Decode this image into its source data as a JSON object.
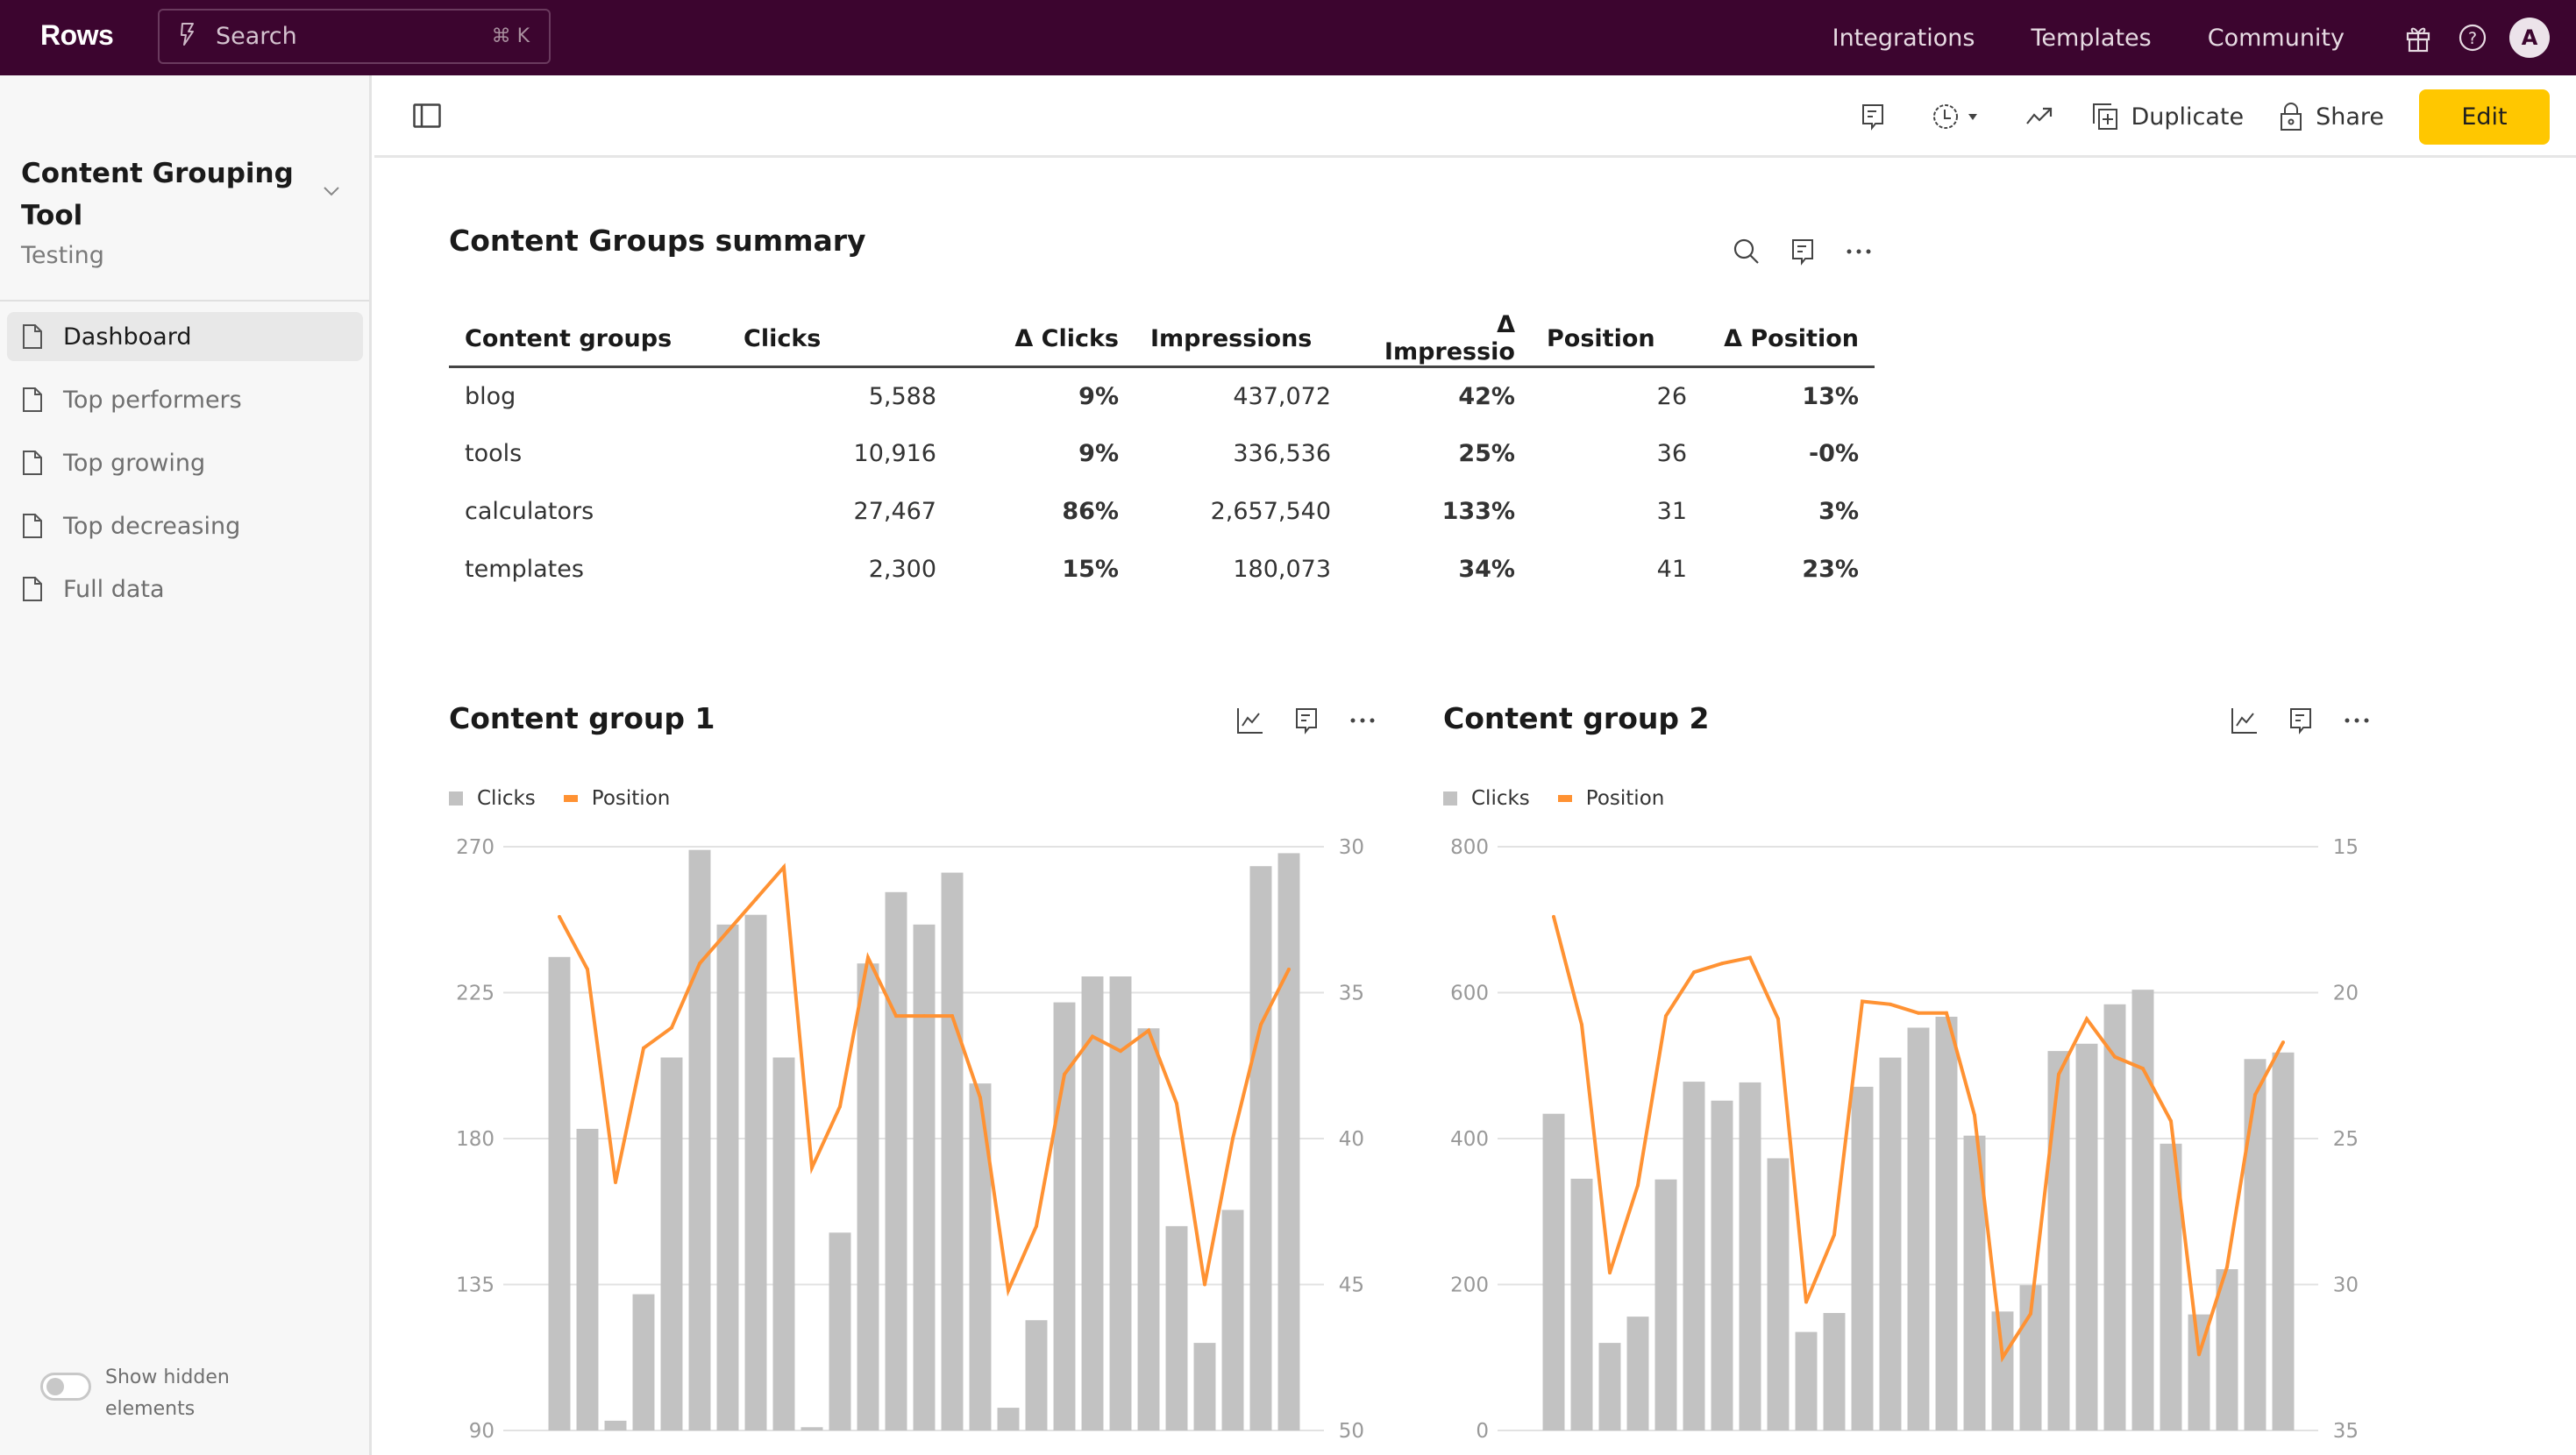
{
  "app": {
    "logo": "Rows",
    "search": {
      "placeholder": "Search",
      "shortcut": "⌘ K",
      "icon": "bolt-icon"
    },
    "nav": [
      "Integrations",
      "Templates",
      "Community"
    ],
    "avatar_initial": "A",
    "icons": [
      "gift-icon",
      "help-icon"
    ]
  },
  "sidebar": {
    "doc_title": "Content Grouping Tool",
    "doc_subtitle": "Testing",
    "items": [
      {
        "label": "Dashboard",
        "active": true
      },
      {
        "label": "Top performers",
        "active": false
      },
      {
        "label": "Top growing",
        "active": false
      },
      {
        "label": "Top decreasing",
        "active": false
      },
      {
        "label": "Full data",
        "active": false
      }
    ],
    "toggle_label": "Show hidden elements",
    "toggle_on": false
  },
  "toolbar": {
    "duplicate_label": "Duplicate",
    "share_label": "Share",
    "edit_label": "Edit"
  },
  "summary": {
    "title": "Content Groups summary",
    "columns": [
      "Content groups",
      "Clicks",
      "Δ Clicks",
      "Impressions",
      "Δ Impressio",
      "Position",
      "Δ Position"
    ],
    "rows": [
      {
        "group": "blog",
        "clicks": "5,588",
        "d_clicks": "9%",
        "impressions": "437,072",
        "d_impressions": "42%",
        "position": "26",
        "d_position": "13%"
      },
      {
        "group": "tools",
        "clicks": "10,916",
        "d_clicks": "9%",
        "impressions": "336,536",
        "d_impressions": "25%",
        "position": "36",
        "d_position": "-0%"
      },
      {
        "group": "calculators",
        "clicks": "27,467",
        "d_clicks": "86%",
        "impressions": "2,657,540",
        "d_impressions": "133%",
        "position": "31",
        "d_position": "3%"
      },
      {
        "group": "templates",
        "clicks": "2,300",
        "d_clicks": "15%",
        "impressions": "180,073",
        "d_impressions": "34%",
        "position": "41",
        "d_position": "23%"
      }
    ],
    "colors": {
      "positive": "#1d7a5a",
      "negative": "#c9391e"
    }
  },
  "chart_data": [
    {
      "type": "bar",
      "title": "Content group 1",
      "legend": [
        "Clicks",
        "Position"
      ],
      "legend_position": "top-left",
      "grid": true,
      "series": [
        {
          "name": "Clicks",
          "type": "bar",
          "axis": "left",
          "color": "#c2c2c2",
          "values": [
            236,
            183,
            93,
            132,
            205,
            269,
            246,
            249,
            205,
            91,
            151,
            234,
            256,
            246,
            262,
            197,
            97,
            124,
            222,
            230,
            230,
            214,
            153,
            117,
            158,
            264,
            268
          ]
        },
        {
          "name": "Position",
          "type": "line",
          "axis": "right",
          "color": "#ff9233",
          "values": [
            32.4,
            34.2,
            41.5,
            36.9,
            36.2,
            34.0,
            32.9,
            31.8,
            30.7,
            41.0,
            38.9,
            33.8,
            35.8,
            35.8,
            35.8,
            38.6,
            45.2,
            43.0,
            37.8,
            36.5,
            37.0,
            36.3,
            38.8,
            45.0,
            40.0,
            36.1,
            34.2
          ]
        }
      ],
      "y_left": {
        "min": 90,
        "max": 270,
        "ticks": [
          270,
          225,
          180,
          135,
          90
        ]
      },
      "y_right": {
        "min": 30,
        "max": 50,
        "inverted": true,
        "ticks": [
          30,
          35,
          40,
          45,
          50
        ]
      }
    },
    {
      "type": "bar",
      "title": "Content group 2",
      "legend": [
        "Clicks",
        "Position"
      ],
      "legend_position": "top-left",
      "grid": true,
      "series": [
        {
          "name": "Clicks",
          "type": "bar",
          "axis": "left",
          "color": "#c2c2c2",
          "values": [
            434,
            345,
            120,
            156,
            344,
            478,
            452,
            477,
            373,
            135,
            161,
            471,
            511,
            552,
            567,
            404,
            163,
            199,
            520,
            530,
            584,
            604,
            393,
            159,
            221,
            509,
            518
          ]
        },
        {
          "name": "Position",
          "type": "line",
          "axis": "right",
          "color": "#ff9233",
          "values": [
            17.4,
            21.1,
            29.6,
            26.6,
            20.8,
            19.3,
            19.0,
            18.8,
            20.9,
            30.6,
            28.3,
            20.3,
            20.4,
            20.7,
            20.7,
            24.2,
            32.5,
            31.0,
            22.8,
            20.9,
            22.2,
            22.6,
            24.4,
            32.4,
            29.4,
            23.5,
            21.7
          ]
        }
      ],
      "y_left": {
        "min": 0,
        "max": 800,
        "ticks": [
          800,
          600,
          400,
          200,
          0
        ]
      },
      "y_right": {
        "min": 15,
        "max": 35,
        "inverted": true,
        "ticks": [
          15,
          20,
          25,
          30,
          35
        ]
      }
    }
  ]
}
